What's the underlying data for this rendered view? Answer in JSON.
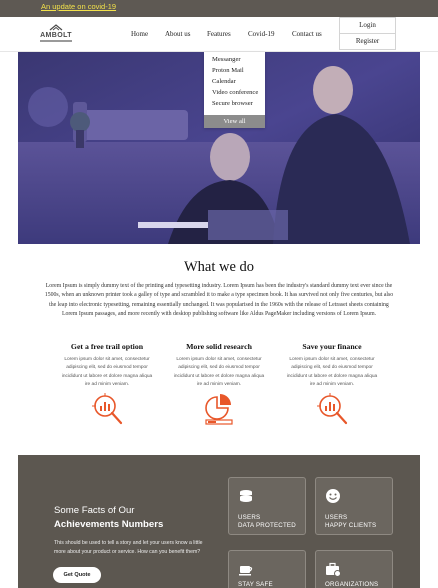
{
  "announcement": {
    "text": "An update on covid-19"
  },
  "header": {
    "logo_text": "AMBOLT",
    "nav": [
      "Home",
      "About us",
      "Features",
      "Covid-19",
      "Contact us"
    ],
    "login_label": "Login",
    "register_label": "Register"
  },
  "features_menu": {
    "items": [
      "Messanger",
      "Proton Mail",
      "Calendar",
      "Video conference",
      "Secure browser"
    ],
    "view_all": "View all"
  },
  "what_we_do": {
    "title": "What we do",
    "intro": "Lorem Ipsum is simply dummy text of the printing and typesetting industry. Lorem Ipsum has been the industry's standard dummy text ever since the 1500s, when an unknown printer took a galley of type and scrambled it to make a type specimen book. It has survived not only five centuries, but also the leap into electronic typesetting, remaining essentially unchanged. It was popularised in the 1960s with the release of Letraset sheets containing Lorem Ipsum passages, and more recently with desktop publishing software like Aldus PageMaker including versions of Lorem Ipsum.",
    "features": [
      {
        "title": "Get a free trail option",
        "body": "Lorem ipsum dolor sit amet, consectetur adipiscing elit, sed do eiusmod tempor incididunt ut labore et dolore magna aliqua ire ad minim veniam.",
        "icon": "magnifier-chart-icon"
      },
      {
        "title": "More solid research",
        "body": "Lorem ipsum dolor sit amet, consectetur adipiscing elit, sed do eiusmod tempor incididunt ut labore et dolore magna aliqua ire ad minim veniam.",
        "icon": "pie-chart-icon"
      },
      {
        "title": "Save your finance",
        "body": "Lorem ipsum dolor sit amet, consectetur adipiscing elit, sed do eiusmod tempor incididunt ut labore et dolore magna aliqua ire ad minim veniam.",
        "icon": "magnifier-chart-icon"
      }
    ]
  },
  "facts": {
    "heading_line1": "Some Facts of Our",
    "heading_line2": "Achievements Numbers",
    "description": "This should be used to tell a story and let your users know a little more about your product or service. How can you benefit them?",
    "cta": "Get Quote",
    "cards": [
      {
        "line1": "USERS",
        "line2": "DATA PROTECTED",
        "icon": "coins-icon"
      },
      {
        "line1": "USERS",
        "line2": "HAPPY CLIENTS",
        "icon": "smiley-icon"
      },
      {
        "line1": "STAY SAFE",
        "line2": "",
        "icon": "coffee-cup-icon"
      },
      {
        "line1": "ORGANIZATIONS",
        "line2": "",
        "icon": "briefcase-icon"
      }
    ]
  },
  "colors": {
    "topbar": "#5e5953",
    "announcement_link": "#f2e14a",
    "hero_tint": "#3c3b7e",
    "accent_icon": "#e8572a",
    "facts_bg": "#5c5750"
  }
}
